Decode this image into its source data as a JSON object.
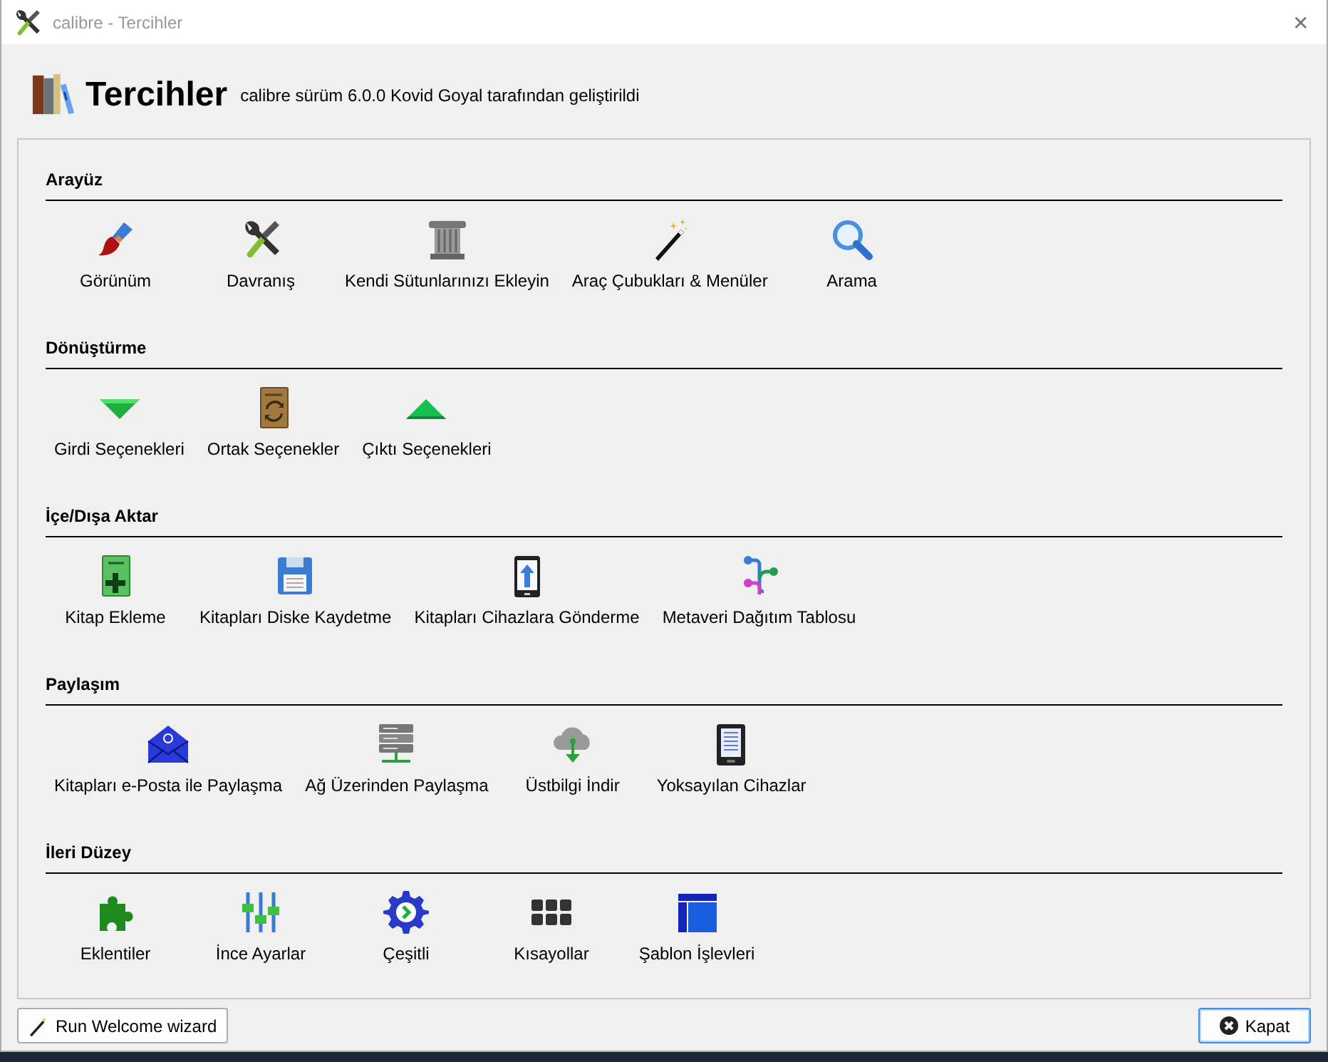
{
  "window": {
    "title": "calibre - Tercihler",
    "close": "✕"
  },
  "header": {
    "title": "Tercihler",
    "subtitle": "calibre sürüm 6.0.0 Kovid Goyal tarafından geliştirildi"
  },
  "sections": [
    {
      "title": "Arayüz",
      "items": [
        {
          "label": "Görünüm"
        },
        {
          "label": "Davranış"
        },
        {
          "label": "Kendi Sütunlarınızı Ekleyin"
        },
        {
          "label": "Araç Çubukları & Menüler"
        },
        {
          "label": "Arama"
        }
      ]
    },
    {
      "title": "Dönüştürme",
      "items": [
        {
          "label": "Girdi Seçenekleri"
        },
        {
          "label": "Ortak Seçenekler"
        },
        {
          "label": "Çıktı Seçenekleri"
        }
      ]
    },
    {
      "title": "İçe/Dışa Aktar",
      "items": [
        {
          "label": "Kitap Ekleme"
        },
        {
          "label": "Kitapları Diske Kaydetme"
        },
        {
          "label": "Kitapları Cihazlara Gönderme"
        },
        {
          "label": "Metaveri Dağıtım Tablosu"
        }
      ]
    },
    {
      "title": "Paylaşım",
      "items": [
        {
          "label": "Kitapları e-Posta ile Paylaşma"
        },
        {
          "label": "Ağ Üzerinden Paylaşma"
        },
        {
          "label": "Üstbilgi İndir"
        },
        {
          "label": "Yoksayılan Cihazlar"
        }
      ]
    },
    {
      "title": "İleri Düzey",
      "items": [
        {
          "label": "Eklentiler"
        },
        {
          "label": "İnce Ayarlar"
        },
        {
          "label": "Çeşitli"
        },
        {
          "label": "Kısayollar"
        },
        {
          "label": "Şablon İşlevleri"
        }
      ]
    }
  ],
  "buttons": [
    {
      "label": "Run Welcome wizard",
      "kind": "wizard"
    },
    {
      "label": "Kapat",
      "kind": "close"
    }
  ]
}
